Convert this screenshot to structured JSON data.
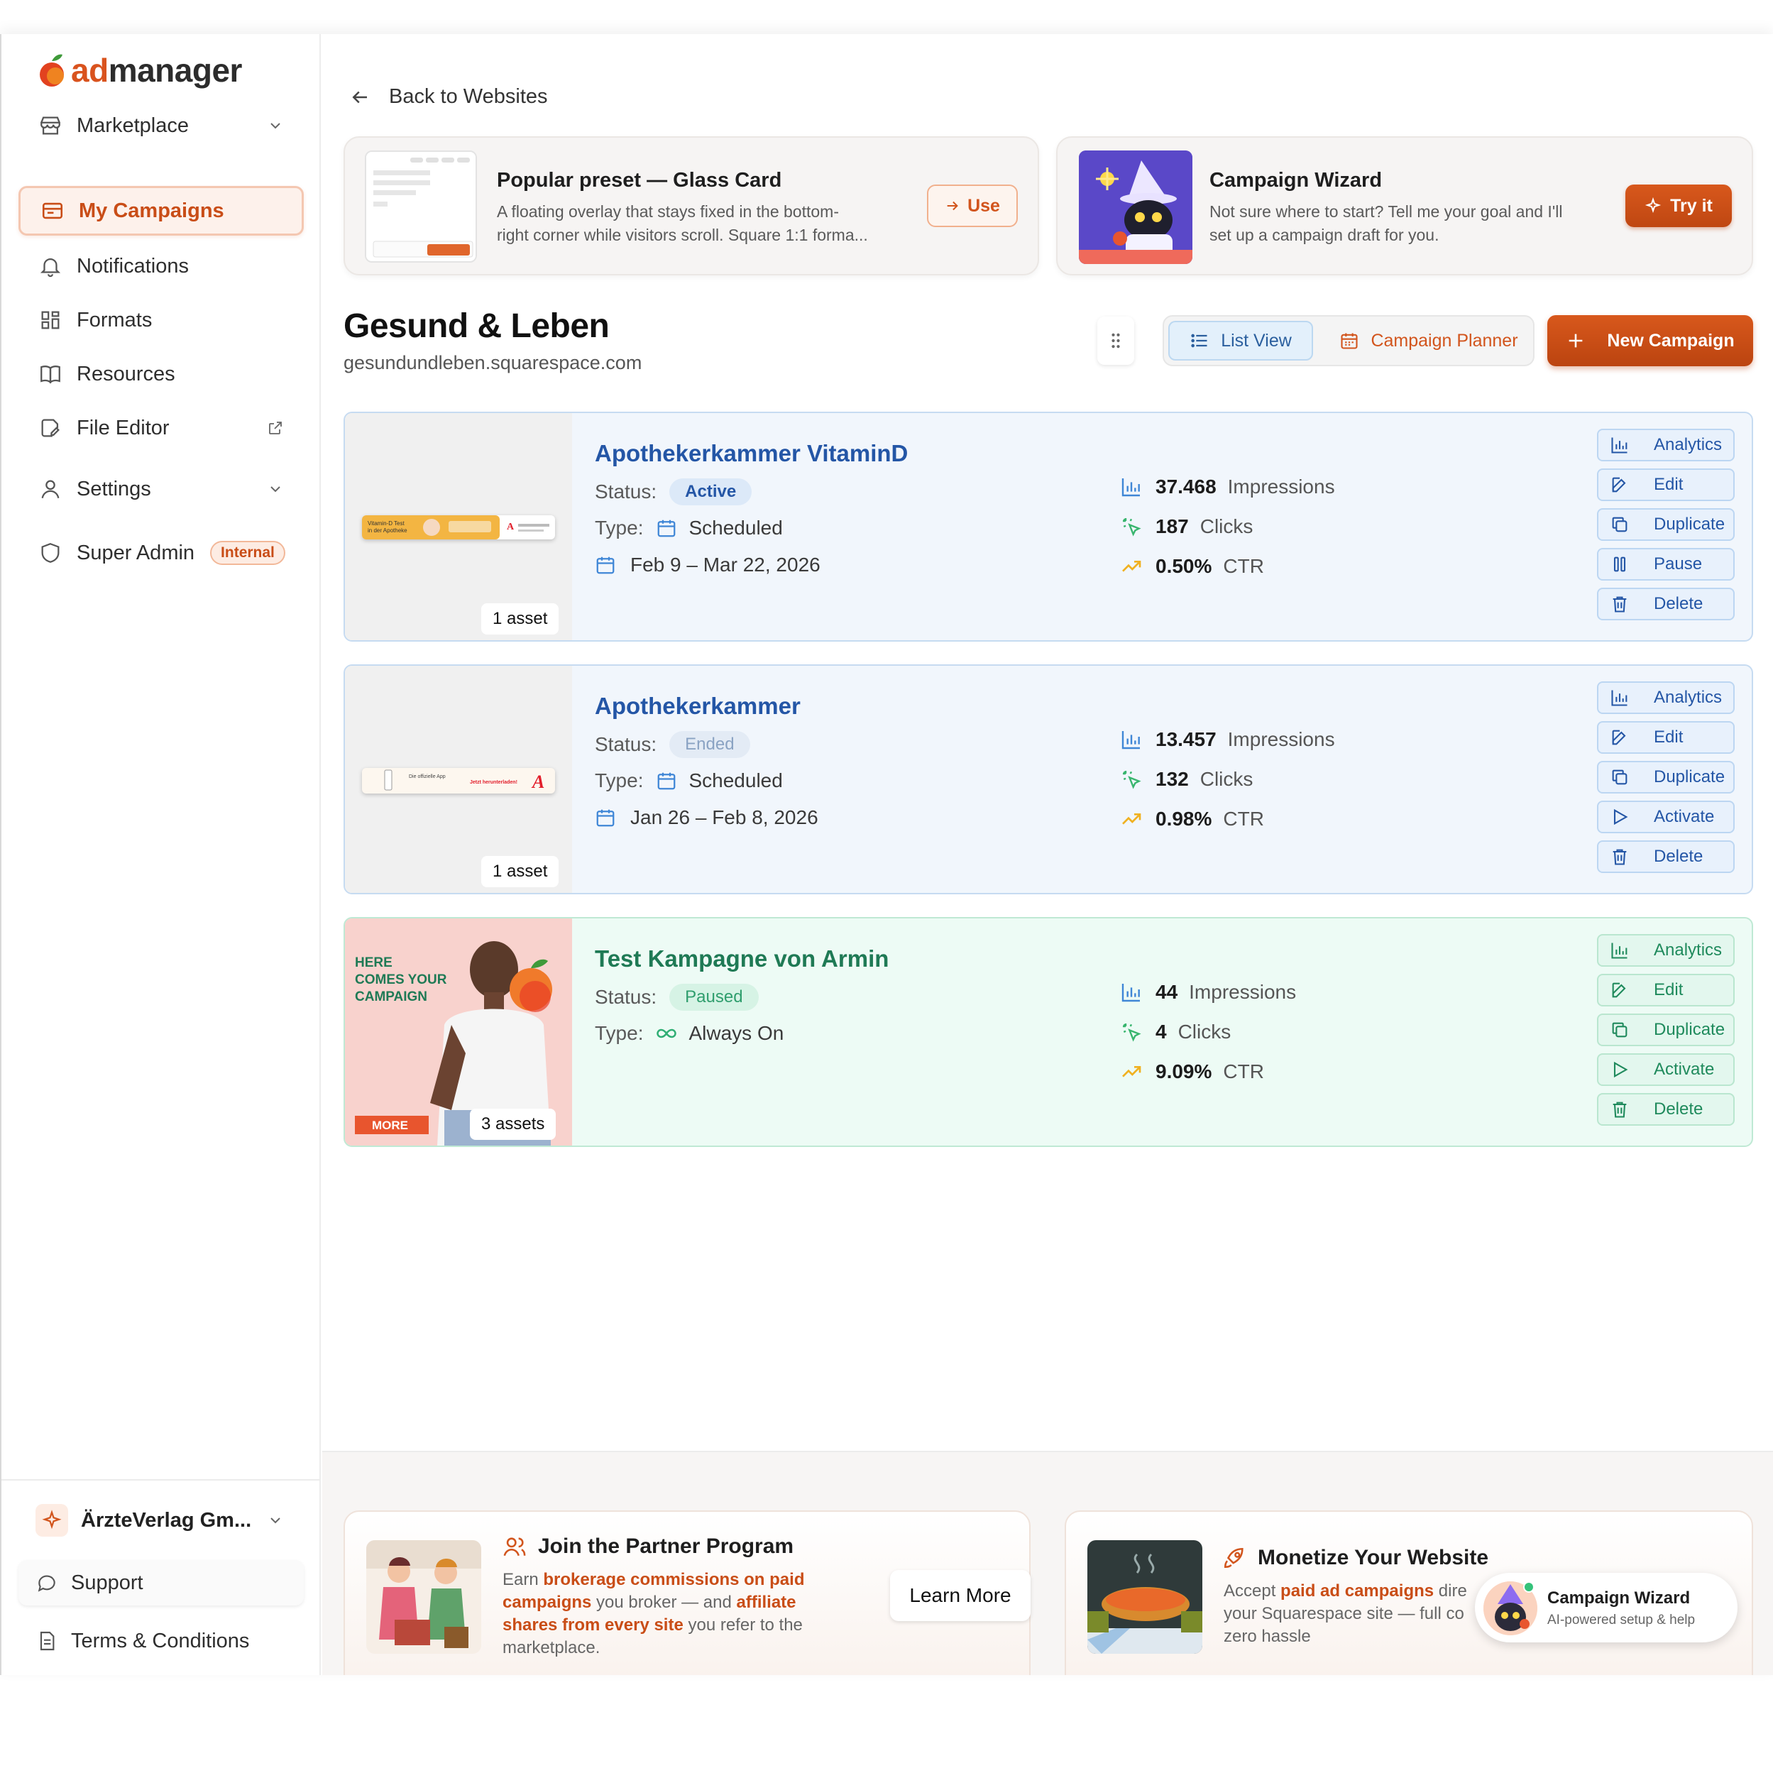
{
  "brand": {
    "name_prefix": "ad",
    "name_suffix": "manager",
    "accent": "#d9531e"
  },
  "sidebar": {
    "items": [
      {
        "label": "Marketplace",
        "icon": "store-icon"
      },
      {
        "label": "My Campaigns",
        "icon": "campaign-icon",
        "active": true
      },
      {
        "label": "Notifications",
        "icon": "bell-icon"
      },
      {
        "label": "Formats",
        "icon": "grid-icon"
      },
      {
        "label": "Resources",
        "icon": "book-icon"
      },
      {
        "label": "File Editor",
        "icon": "file-edit-icon"
      },
      {
        "label": "Settings",
        "icon": "user-icon"
      },
      {
        "label": "Super Admin",
        "icon": "shield-icon",
        "badge": "Internal"
      }
    ],
    "org": "ÄrzteVerlag Gm...",
    "support": "Support",
    "terms": "Terms & Conditions"
  },
  "header": {
    "back_label": "Back to Websites"
  },
  "promos": {
    "preset": {
      "title": "Popular preset — Glass Card",
      "desc_line1": "A floating overlay that stays fixed in the bottom-",
      "desc_line2": "right corner while visitors scroll. Square 1:1 forma...",
      "button": "Use"
    },
    "wizard": {
      "title": "Campaign Wizard",
      "desc_line1": "Not sure where to start? Tell me your goal and I'll",
      "desc_line2": "set up a campaign draft for you.",
      "button": "Try it"
    }
  },
  "site": {
    "title": "Gesund & Leben",
    "url": "gesundundleben.squarespace.com"
  },
  "toolbar": {
    "list_view": "List View",
    "planner": "Campaign Planner",
    "new_campaign": "New Campaign"
  },
  "labels": {
    "status": "Status:",
    "type": "Type:",
    "impressions": "Impressions",
    "clicks": "Clicks",
    "ctr": "CTR"
  },
  "actions": {
    "analytics": "Analytics",
    "edit": "Edit",
    "duplicate": "Duplicate",
    "delete": "Delete"
  },
  "campaigns": [
    {
      "name": "Apothekerkammer VitaminD",
      "status": "Active",
      "type": "Scheduled",
      "dates": "Feb 9 – Mar 22, 2026",
      "impressions": "37.468",
      "clicks": "187",
      "ctr": "0.50%",
      "assets": "1 asset",
      "toggle": "Pause",
      "banner_text1": "Vitamin-D Test",
      "banner_text2": "in der Apotheke"
    },
    {
      "name": "Apothekerkammer",
      "status": "Ended",
      "type": "Scheduled",
      "dates": "Jan 26 – Feb 8, 2026",
      "impressions": "13.457",
      "clicks": "132",
      "ctr": "0.98%",
      "assets": "1 asset",
      "toggle": "Activate",
      "banner_text1": "Die offizielle App",
      "banner_text2": "Jetzt herunterladen!"
    },
    {
      "name": "Test Kampagne von Armin",
      "status": "Paused",
      "type": "Always On",
      "impressions": "44",
      "clicks": "4",
      "ctr": "9.09%",
      "assets": "3 assets",
      "toggle": "Activate",
      "preview_line1": "HERE",
      "preview_line2": "COMES YOUR",
      "preview_line3": "CAMPAIGN",
      "preview_more": "MORE"
    }
  ],
  "footer": {
    "partner": {
      "title": "Join the Partner Program",
      "t1": "Earn ",
      "b1": "brokerage commissions on paid campaigns",
      "t2": " you broker — and ",
      "b2": "affiliate shares from every site",
      "t3": " you refer to the marketplace.",
      "button": "Learn More"
    },
    "monetize": {
      "title": "Monetize Your Website",
      "t1": "Accept ",
      "b1": "paid ad campaigns",
      "t2": " dire",
      "t3": "your Squarespace site — full co",
      "t4": "zero hassle"
    }
  },
  "wizard_widget": {
    "title": "Campaign Wizard",
    "subtitle": "AI-powered setup & help"
  }
}
